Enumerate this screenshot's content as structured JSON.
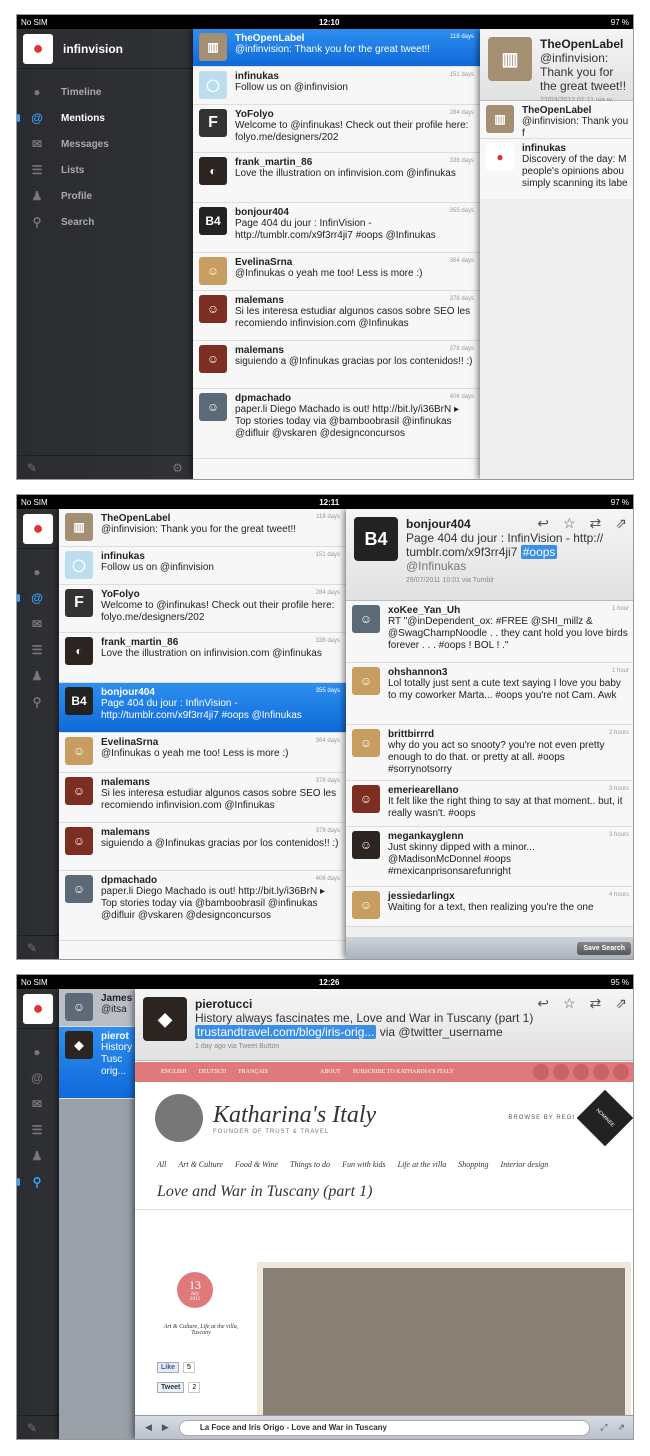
{
  "f1": {
    "status": {
      "carrier": "No SIM",
      "time": "12:10",
      "battery": "97 %"
    },
    "user": "infinvision",
    "nav": [
      "Timeline",
      "Mentions",
      "Messages",
      "Lists",
      "Profile",
      "Search"
    ],
    "tweets": [
      {
        "name": "TheOpenLabel",
        "text": "@infinvision: Thank you for the great tweet!!",
        "time": "118 days"
      },
      {
        "name": "infinukas",
        "text": "Follow us on @infinvision",
        "time": "151 days"
      },
      {
        "name": "YoFolyo",
        "text": "Welcome to @infinukas! Check out their profile here: folyo.me/designers/202",
        "time": "284 days"
      },
      {
        "name": "frank_martin_86",
        "text": "Love the illustration on infinvision.com @infinukas",
        "time": "338 days"
      },
      {
        "name": "bonjour404",
        "text": "Page 404 du jour : InfinVision - http://tumblr.com/x9f3rr4ji7 #oops @Infinukas",
        "time": "355 days"
      },
      {
        "name": "EvelinaSrna",
        "text": "@Infinukas o yeah me too! Less is more :)",
        "time": "364 days"
      },
      {
        "name": "malemans",
        "text": "Si les interesa estudiar algunos casos sobre SEO les recomiendo infinvision.com @Infinukas",
        "time": "378 days"
      },
      {
        "name": "malemans",
        "text": "siguiendo a @Infinukas gracias por los contenidos!! :)",
        "time": "378 days"
      },
      {
        "name": "dpmachado",
        "text": "paper.li Diego  Machado is out! http://bit.ly/i36BrN ▸ Top stories today via @bamboobrasil @infinukas @difluir @vskaren @designconcursos",
        "time": "406 days"
      }
    ],
    "detail": {
      "name": "TheOpenLabel",
      "text": "@infinvision: Thank you for the great tweet!!",
      "meta": "22/03/2012 01:11 via w",
      "replies": [
        {
          "name": "TheOpenLabel",
          "text": "@infinvision: Thank you f"
        },
        {
          "name": "infinukas",
          "text": "Discovery of the day: M people's opinions abou simply scanning its labe"
        }
      ]
    }
  },
  "f2": {
    "status": {
      "carrier": "No SIM",
      "time": "12:11",
      "battery": "97 %"
    },
    "detail": {
      "name": "bonjour404",
      "text_a": "Page 404 du jour : InfinVision - http://",
      "text_b": "tumblr.com/x9f3rr4ji7",
      "hashtag": "#oops",
      "mention": "@Infinukas",
      "meta": "29/07/2011 10:01 via Tumblr"
    },
    "search": [
      {
        "name": "xoKee_Yan_Uh",
        "text": "RT \"@inDependent_ox: #FREE @SHI_millz  & @SwagChampNoodle  . . they cant hold you love birds forever . . .  #oops ! BOL ! .\"",
        "time": "1 hour"
      },
      {
        "name": "ohshannon3",
        "text": "Lol totally just sent a cute text saying I love you baby to my coworker Marta... #oops you're not Cam. Awk",
        "time": "1 hour"
      },
      {
        "name": "brittbirrrd",
        "text": "why do you act so snooty? you're not even pretty enough to do that. or pretty at all. #oops #sorrynotsorry",
        "time": "2 hours"
      },
      {
        "name": "emeriearellano",
        "text": "It felt like the right thing to say at that moment.. but, it really wasn't. #oops",
        "time": "3 hours"
      },
      {
        "name": "megankayglenn",
        "text": "Just skinny dipped with a minor... @MadisonMcDonnel #oops #mexicanprisonsarefunright",
        "time": "3 hours"
      },
      {
        "name": "jessiedarlingx",
        "text": "Waiting for a text, then realizing you're the one",
        "time": "4 hours"
      }
    ],
    "save_search": "Save Search"
  },
  "f3": {
    "status": {
      "carrier": "No SIM",
      "time": "12:26",
      "battery": "95 %"
    },
    "list": [
      {
        "name": "James",
        "text": "@itsa"
      },
      {
        "name": "pierot",
        "text": "History Tusc orig..."
      }
    ],
    "detail": {
      "name": "pierotucci",
      "text": "History always fascinates me, Love and War in Tuscany (part 1)",
      "link": "trustandtravel.com/blog/iris-orig...",
      "via": "via @twitter_username",
      "meta": "1 day ago via Tweet Button"
    },
    "web": {
      "topnav": [
        "ENGLISH",
        "DEUTSCH",
        "FRANÇAIS",
        "ABOUT",
        "SUBSCRIBE TO KATHARINA'S ITALY"
      ],
      "site_title": "Katharina's Italy",
      "site_sub": "FOUNDER OF TRUST & TRAVEL",
      "browse": "BROWSE BY REGI",
      "categories": [
        "All",
        "Art & Culture",
        "Food & Wine",
        "Things to do",
        "Fun with kids",
        "Life at the villa",
        "Shopping",
        "Interior design"
      ],
      "post_title": "Love and War in Tuscany (part 1)",
      "date_day": "13",
      "date_month": "July",
      "date_year": "2012",
      "tags": "Art & Culture, Life at the villa, Tuscany",
      "like": "Like",
      "like_count": "5",
      "tweet": "Tweet",
      "tweet_count": "2",
      "nominee": "NOMINEE"
    },
    "url_title": "La Foce and Iris Origo - Love and War in Tuscany"
  }
}
